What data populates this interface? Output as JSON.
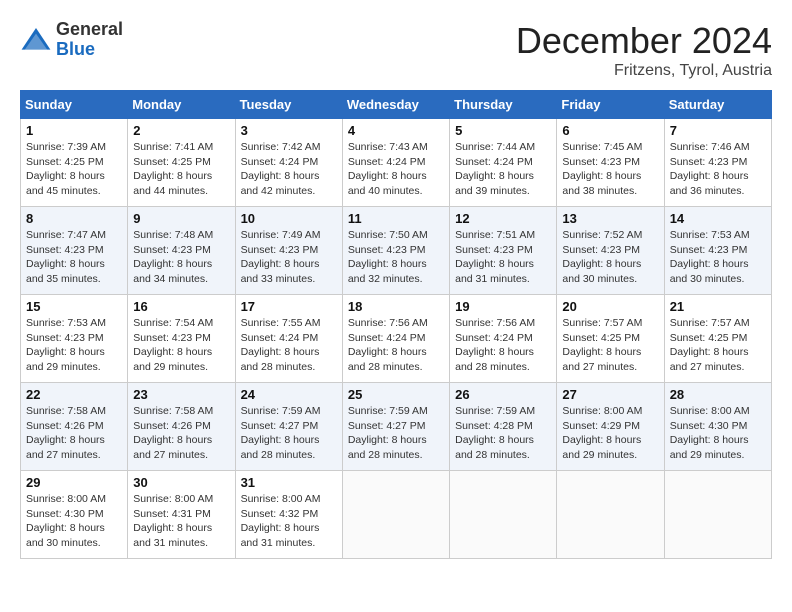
{
  "header": {
    "logo_line1": "General",
    "logo_line2": "Blue",
    "month": "December 2024",
    "location": "Fritzens, Tyrol, Austria"
  },
  "weekdays": [
    "Sunday",
    "Monday",
    "Tuesday",
    "Wednesday",
    "Thursday",
    "Friday",
    "Saturday"
  ],
  "weeks": [
    [
      {
        "day": "1",
        "sunrise": "7:39 AM",
        "sunset": "4:25 PM",
        "daylight": "8 hours and 45 minutes."
      },
      {
        "day": "2",
        "sunrise": "7:41 AM",
        "sunset": "4:25 PM",
        "daylight": "8 hours and 44 minutes."
      },
      {
        "day": "3",
        "sunrise": "7:42 AM",
        "sunset": "4:24 PM",
        "daylight": "8 hours and 42 minutes."
      },
      {
        "day": "4",
        "sunrise": "7:43 AM",
        "sunset": "4:24 PM",
        "daylight": "8 hours and 40 minutes."
      },
      {
        "day": "5",
        "sunrise": "7:44 AM",
        "sunset": "4:24 PM",
        "daylight": "8 hours and 39 minutes."
      },
      {
        "day": "6",
        "sunrise": "7:45 AM",
        "sunset": "4:23 PM",
        "daylight": "8 hours and 38 minutes."
      },
      {
        "day": "7",
        "sunrise": "7:46 AM",
        "sunset": "4:23 PM",
        "daylight": "8 hours and 36 minutes."
      }
    ],
    [
      {
        "day": "8",
        "sunrise": "7:47 AM",
        "sunset": "4:23 PM",
        "daylight": "8 hours and 35 minutes."
      },
      {
        "day": "9",
        "sunrise": "7:48 AM",
        "sunset": "4:23 PM",
        "daylight": "8 hours and 34 minutes."
      },
      {
        "day": "10",
        "sunrise": "7:49 AM",
        "sunset": "4:23 PM",
        "daylight": "8 hours and 33 minutes."
      },
      {
        "day": "11",
        "sunrise": "7:50 AM",
        "sunset": "4:23 PM",
        "daylight": "8 hours and 32 minutes."
      },
      {
        "day": "12",
        "sunrise": "7:51 AM",
        "sunset": "4:23 PM",
        "daylight": "8 hours and 31 minutes."
      },
      {
        "day": "13",
        "sunrise": "7:52 AM",
        "sunset": "4:23 PM",
        "daylight": "8 hours and 30 minutes."
      },
      {
        "day": "14",
        "sunrise": "7:53 AM",
        "sunset": "4:23 PM",
        "daylight": "8 hours and 30 minutes."
      }
    ],
    [
      {
        "day": "15",
        "sunrise": "7:53 AM",
        "sunset": "4:23 PM",
        "daylight": "8 hours and 29 minutes."
      },
      {
        "day": "16",
        "sunrise": "7:54 AM",
        "sunset": "4:23 PM",
        "daylight": "8 hours and 29 minutes."
      },
      {
        "day": "17",
        "sunrise": "7:55 AM",
        "sunset": "4:24 PM",
        "daylight": "8 hours and 28 minutes."
      },
      {
        "day": "18",
        "sunrise": "7:56 AM",
        "sunset": "4:24 PM",
        "daylight": "8 hours and 28 minutes."
      },
      {
        "day": "19",
        "sunrise": "7:56 AM",
        "sunset": "4:24 PM",
        "daylight": "8 hours and 28 minutes."
      },
      {
        "day": "20",
        "sunrise": "7:57 AM",
        "sunset": "4:25 PM",
        "daylight": "8 hours and 27 minutes."
      },
      {
        "day": "21",
        "sunrise": "7:57 AM",
        "sunset": "4:25 PM",
        "daylight": "8 hours and 27 minutes."
      }
    ],
    [
      {
        "day": "22",
        "sunrise": "7:58 AM",
        "sunset": "4:26 PM",
        "daylight": "8 hours and 27 minutes."
      },
      {
        "day": "23",
        "sunrise": "7:58 AM",
        "sunset": "4:26 PM",
        "daylight": "8 hours and 27 minutes."
      },
      {
        "day": "24",
        "sunrise": "7:59 AM",
        "sunset": "4:27 PM",
        "daylight": "8 hours and 28 minutes."
      },
      {
        "day": "25",
        "sunrise": "7:59 AM",
        "sunset": "4:27 PM",
        "daylight": "8 hours and 28 minutes."
      },
      {
        "day": "26",
        "sunrise": "7:59 AM",
        "sunset": "4:28 PM",
        "daylight": "8 hours and 28 minutes."
      },
      {
        "day": "27",
        "sunrise": "8:00 AM",
        "sunset": "4:29 PM",
        "daylight": "8 hours and 29 minutes."
      },
      {
        "day": "28",
        "sunrise": "8:00 AM",
        "sunset": "4:30 PM",
        "daylight": "8 hours and 29 minutes."
      }
    ],
    [
      {
        "day": "29",
        "sunrise": "8:00 AM",
        "sunset": "4:30 PM",
        "daylight": "8 hours and 30 minutes."
      },
      {
        "day": "30",
        "sunrise": "8:00 AM",
        "sunset": "4:31 PM",
        "daylight": "8 hours and 31 minutes."
      },
      {
        "day": "31",
        "sunrise": "8:00 AM",
        "sunset": "4:32 PM",
        "daylight": "8 hours and 31 minutes."
      },
      null,
      null,
      null,
      null
    ]
  ],
  "labels": {
    "sunrise": "Sunrise:",
    "sunset": "Sunset:",
    "daylight": "Daylight:"
  }
}
